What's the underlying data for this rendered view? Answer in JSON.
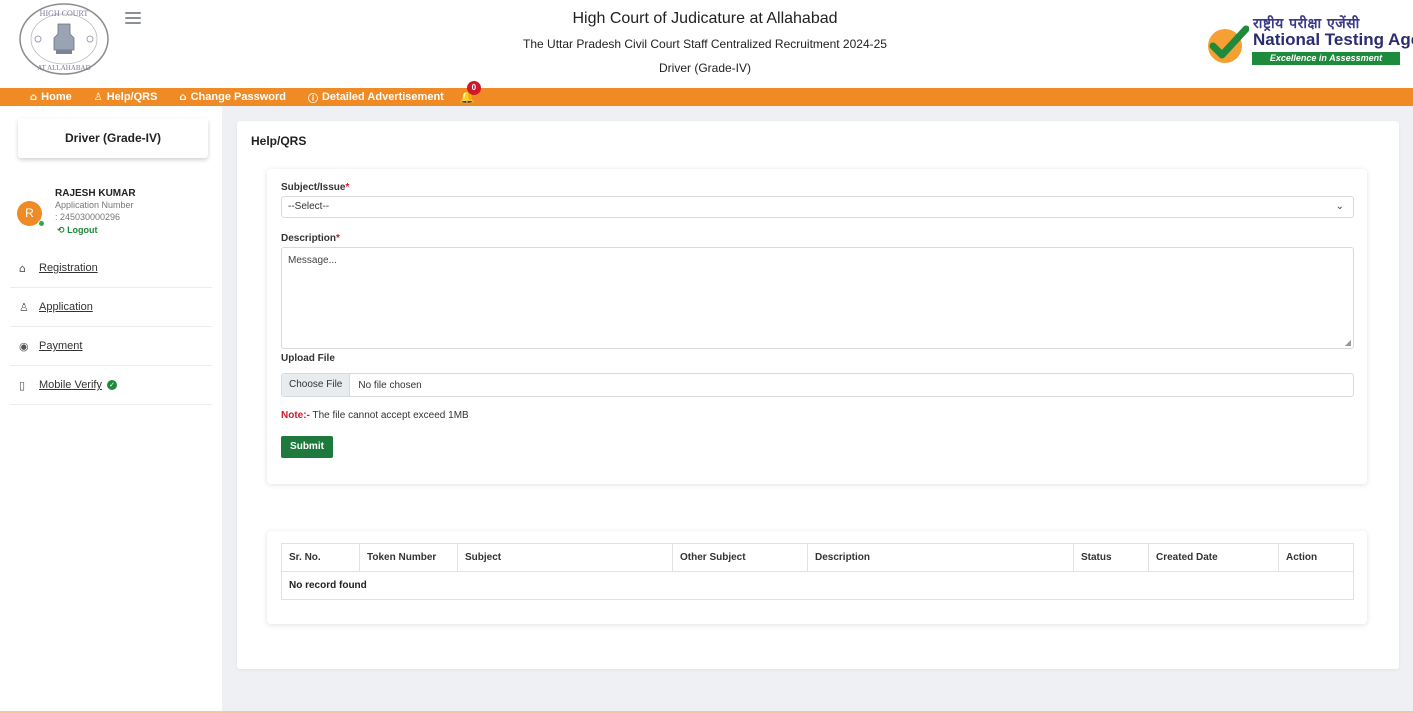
{
  "header": {
    "title": "High Court of Judicature at Allahabad",
    "subtitle": "The Uttar Pradesh Civil Court Staff Centralized Recruitment 2024-25",
    "post": "Driver (Grade-IV)",
    "court_logo_text_top": "HIGH COURT",
    "court_logo_text_bottom": "AT ALLAHABAD",
    "nta_hindi": "राष्ट्रीय परीक्षा एजेंसी",
    "nta_english": "National Testing Agency",
    "nta_tagline": "Excellence in Assessment"
  },
  "nav": {
    "items": [
      {
        "icon": "home-icon",
        "label": "Home"
      },
      {
        "icon": "user-icon",
        "label": "Help/QRS"
      },
      {
        "icon": "lock-icon",
        "label": "Change Password"
      },
      {
        "icon": "info-icon",
        "label": "Detailed Advertisement"
      }
    ],
    "notification_count": "0"
  },
  "sidebar": {
    "post_title": "Driver (Grade-IV)",
    "avatar_initial": "R",
    "user_name": "RAJESH KUMAR",
    "application_label": "Application Number",
    "application_number": ": 245030000296",
    "logout_label": "Logout",
    "items": [
      {
        "icon": "home-outline-icon",
        "label": "Registration"
      },
      {
        "icon": "user-add-icon",
        "label": "Application"
      },
      {
        "icon": "payment-icon",
        "label": "Payment"
      },
      {
        "icon": "mobile-icon",
        "label": "Mobile Verify"
      }
    ]
  },
  "main": {
    "page_title": "Help/QRS",
    "form": {
      "subject_label": "Subject/Issue",
      "subject_value": "--Select--",
      "description_label": "Description",
      "description_placeholder": "Message...",
      "upload_label": "Upload File",
      "choose_file_label": "Choose File",
      "no_file_text": "No file chosen",
      "note_prefix": "Note:-",
      "note_text": "The file cannot accept exceed 1MB",
      "submit_label": "Submit"
    },
    "table": {
      "columns": [
        "Sr. No.",
        "Token Number",
        "Subject",
        "Other Subject",
        "Description",
        "Status",
        "Created Date",
        "Action"
      ],
      "empty_text": "No record found"
    }
  },
  "colors": {
    "accent": "#f08a24",
    "success": "#1d7a3c",
    "required": "#d0192b"
  }
}
